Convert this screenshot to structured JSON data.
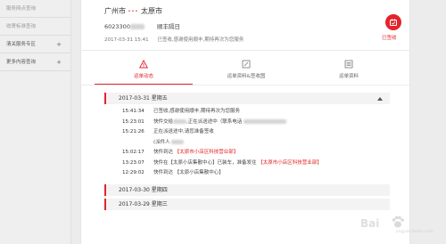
{
  "sidebar": {
    "items": [
      {
        "label": "服务网点查询",
        "expandable": false,
        "dim": true
      },
      {
        "label": "收寄标准查询",
        "expandable": false,
        "dim": true
      },
      {
        "label": "清关服务专区",
        "expandable": true,
        "dim": false
      },
      {
        "label": "更多内容查询",
        "expandable": true,
        "dim": false
      }
    ],
    "expand_glyph": "+"
  },
  "shipment": {
    "origin": "广州市",
    "arrow_text": "•••",
    "destination": "太原市",
    "tracking_prefix": "6023300",
    "carrier": "顺丰隔日",
    "date_time": "2017-03-31 15:41",
    "latest_status": "已签收,感谢使用顺丰,期待再次为您服务",
    "status_badge": "已签收",
    "accent_color": "#e3232c"
  },
  "tabs": [
    {
      "label": "运单动态",
      "icon": "alert-triangle-icon",
      "active": true
    },
    {
      "label": "运单资料&签收图",
      "icon": "image-edit-icon",
      "active": false
    },
    {
      "label": "运单资料",
      "icon": "list-icon",
      "active": false
    }
  ],
  "timeline": {
    "days": [
      {
        "date": "2017-03-31",
        "weekday": "星期五",
        "expanded": true,
        "events": [
          {
            "time": "15:41:34",
            "pre": "已签收,感谢使用顺丰,期待再次为您服务",
            "hl": "",
            "post": ""
          },
          {
            "time": "15:23:01",
            "pre": "快件交给",
            "hl": "",
            "post": ",正在派送途中（联系电话"
          },
          {
            "time": "15:21:26",
            "pre": "正在派送途中,请您准备签收",
            "hl": "",
            "post": ""
          },
          {
            "time": "",
            "pre": "(派件人",
            "hl": "",
            "post": ""
          },
          {
            "time": "15:02:17",
            "pre": "快件到达 ",
            "hl": "【太原市小店区科技营业部】",
            "post": ""
          },
          {
            "time": "13:23:07",
            "pre": "快件在【太原小店集散中心】已装车，准备发往 ",
            "hl": "【太原市小店区科技营业部】",
            "post": ""
          },
          {
            "time": "12:29:02",
            "pre": "快件到达 【太原小店集散中心】",
            "hl": "",
            "post": ""
          }
        ]
      },
      {
        "date": "2017-03-30",
        "weekday": "星期四",
        "expanded": false,
        "events": []
      },
      {
        "date": "2017-03-29",
        "weekday": "星期三",
        "expanded": false,
        "events": []
      }
    ]
  },
  "watermark": {
    "brand": "Bai",
    "url": "jingyan.baidu.com"
  }
}
